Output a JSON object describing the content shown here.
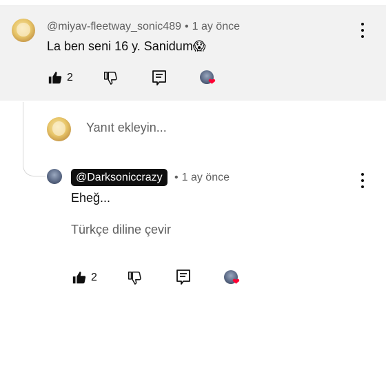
{
  "comment": {
    "author": "@miyav-fleetway_sonic489",
    "separator": "•",
    "time": "1 ay önce",
    "text": "La ben seni 16 y. Sanidum😱",
    "likes": "2"
  },
  "reply_box": {
    "placeholder": "Yanıt ekleyin..."
  },
  "reply": {
    "author": "@Darksoniccrazy",
    "separator": "•",
    "time": "1 ay önce",
    "text": "Eheğ...",
    "translate_label": "Türkçe diline çevir",
    "likes": "2"
  },
  "icons": {
    "like": "thumbs-up-icon",
    "dislike": "thumbs-down-icon",
    "reply": "comment-icon",
    "creator_heart": "creator-heart-icon",
    "more": "more-vert-icon"
  },
  "colors": {
    "heart": "#ff0033",
    "highlight_bg": "#f2f2f2",
    "secondary_text": "#606060"
  }
}
